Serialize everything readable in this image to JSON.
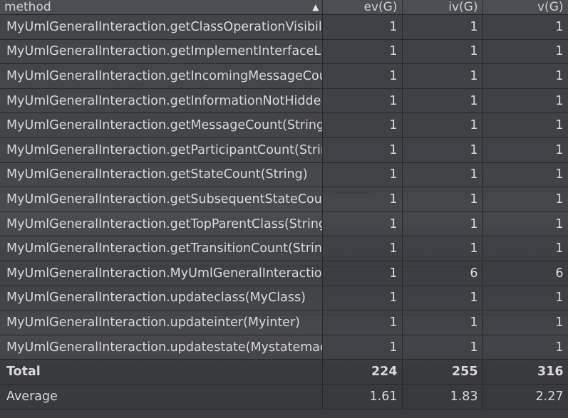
{
  "columns": {
    "method": "method",
    "ev": "ev(G)",
    "iv": "iv(G)",
    "v": "v(G)",
    "sort_icon": "sort-ascending-icon"
  },
  "rows": [
    {
      "method": "MyUmlGeneralInteraction.getClassOperationVisibili",
      "ev": "1",
      "iv": "1",
      "v": "1"
    },
    {
      "method": "MyUmlGeneralInteraction.getImplementInterfaceLis",
      "ev": "1",
      "iv": "1",
      "v": "1"
    },
    {
      "method": "MyUmlGeneralInteraction.getIncomingMessageCou",
      "ev": "1",
      "iv": "1",
      "v": "1"
    },
    {
      "method": "MyUmlGeneralInteraction.getInformationNotHidde",
      "ev": "1",
      "iv": "1",
      "v": "1"
    },
    {
      "method": "MyUmlGeneralInteraction.getMessageCount(String)",
      "ev": "1",
      "iv": "1",
      "v": "1"
    },
    {
      "method": "MyUmlGeneralInteraction.getParticipantCount(Strir",
      "ev": "1",
      "iv": "1",
      "v": "1"
    },
    {
      "method": "MyUmlGeneralInteraction.getStateCount(String)",
      "ev": "1",
      "iv": "1",
      "v": "1"
    },
    {
      "method": "MyUmlGeneralInteraction.getSubsequentStateCour",
      "ev": "1",
      "iv": "1",
      "v": "1"
    },
    {
      "method": "MyUmlGeneralInteraction.getTopParentClass(String",
      "ev": "1",
      "iv": "1",
      "v": "1"
    },
    {
      "method": "MyUmlGeneralInteraction.getTransitionCount(String",
      "ev": "1",
      "iv": "1",
      "v": "1"
    },
    {
      "method": "MyUmlGeneralInteraction.MyUmlGeneralInteractior",
      "ev": "1",
      "iv": "6",
      "v": "6"
    },
    {
      "method": "MyUmlGeneralInteraction.updateclass(MyClass)",
      "ev": "1",
      "iv": "1",
      "v": "1"
    },
    {
      "method": "MyUmlGeneralInteraction.updateinter(Myinter)",
      "ev": "1",
      "iv": "1",
      "v": "1"
    },
    {
      "method": "MyUmlGeneralInteraction.updatestate(Mystatemac",
      "ev": "1",
      "iv": "1",
      "v": "1"
    }
  ],
  "total": {
    "label": "Total",
    "ev": "224",
    "iv": "255",
    "v": "316"
  },
  "average": {
    "label": "Average",
    "ev": "1.61",
    "iv": "1.83",
    "v": "2.27"
  }
}
